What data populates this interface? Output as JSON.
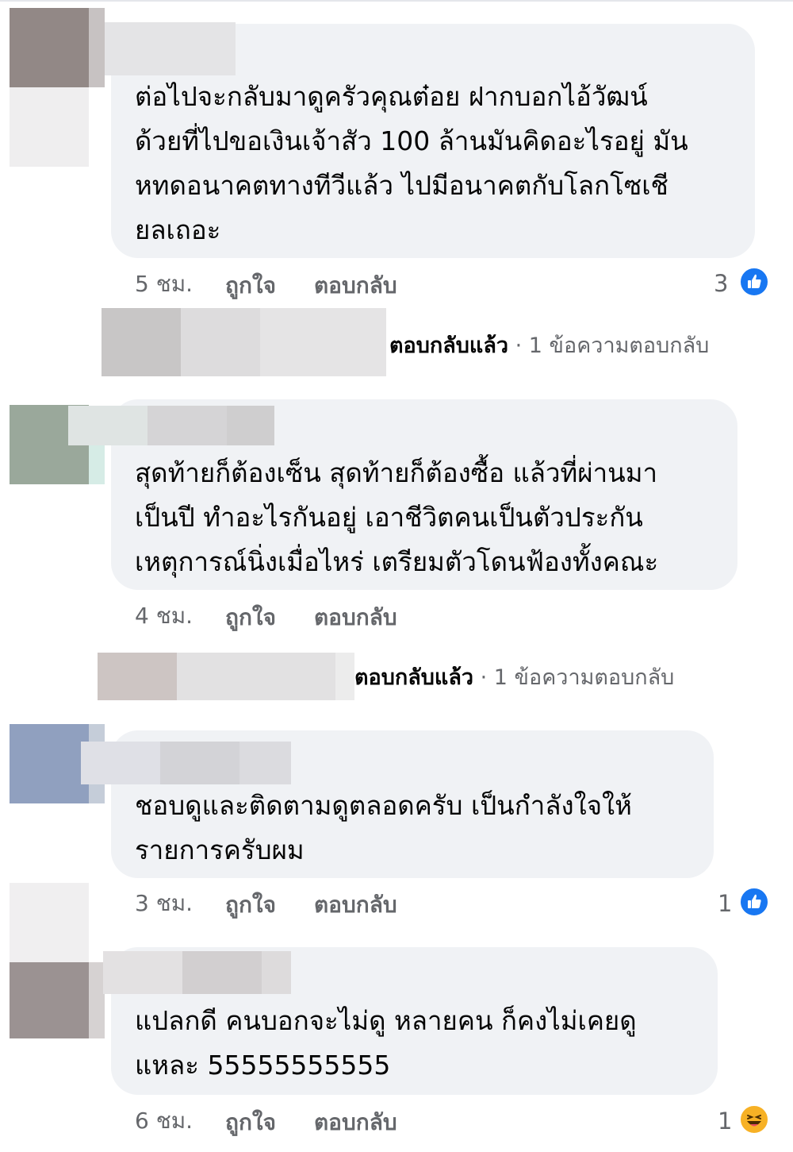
{
  "comments": [
    {
      "lines": [
        "ต่อไปจะกลับมาดูครัวคุณต๋อย ฝากบอกไอ้วัฒน์",
        "ด้วยที่ไปขอเงินเจ้าสัว 100 ล้านมันคิดอะไรอยู่ มัน",
        "หทดอนาคตทางทีวีแล้ว ไปมีอนาคตกับโลกโซเชี",
        "ยลเถอะ"
      ],
      "time": "5 ชม.",
      "like_label": "ถูกใจ",
      "reply_label": "ตอบกลับ",
      "reaction_count": "3",
      "reaction_icon": "like-icon",
      "replied": {
        "label": "ตอบกลับแล้ว",
        "sep": " · ",
        "count": "1 ข้อความตอบกลับ"
      }
    },
    {
      "lines": [
        "สุดท้ายก็ต้องเซ็น สุดท้ายก็ต้องซื้อ แล้วที่ผ่านมา",
        "เป็นปี ทำอะไรกันอยู่ เอาชีวิตคนเป็นตัวประกัน",
        "เหตุการณ์นิ่งเมื่อไหร่ เตรียมตัวโดนฟ้องทั้งคณะ"
      ],
      "time": "4 ชม.",
      "like_label": "ถูกใจ",
      "reply_label": "ตอบกลับ",
      "replied": {
        "label": "ตอบกลับแล้ว",
        "sep": " · ",
        "count": "1 ข้อความตอบกลับ"
      }
    },
    {
      "lines": [
        "ชอบดูและติดตามดูตลอดครับ เป็นกำลังใจให้",
        "รายการครับผม"
      ],
      "time": "3 ชม.",
      "like_label": "ถูกใจ",
      "reply_label": "ตอบกลับ",
      "reaction_count": "1",
      "reaction_icon": "like-icon"
    },
    {
      "lines": [
        "แปลกดี คนบอกจะไม่ดู หลายคน ก็คงไม่เคยดู",
        "แหละ 55555555555"
      ],
      "time": "6 ชม.",
      "like_label": "ถูกใจ",
      "reply_label": "ตอบกลับ",
      "reaction_count": "1",
      "reaction_icon": "haha-icon"
    }
  ],
  "colors": {
    "bubble": "#f0f2f5",
    "meta_text": "#65676b",
    "like_blue": "#1877f2",
    "haha_yellow": "#f7b125"
  }
}
